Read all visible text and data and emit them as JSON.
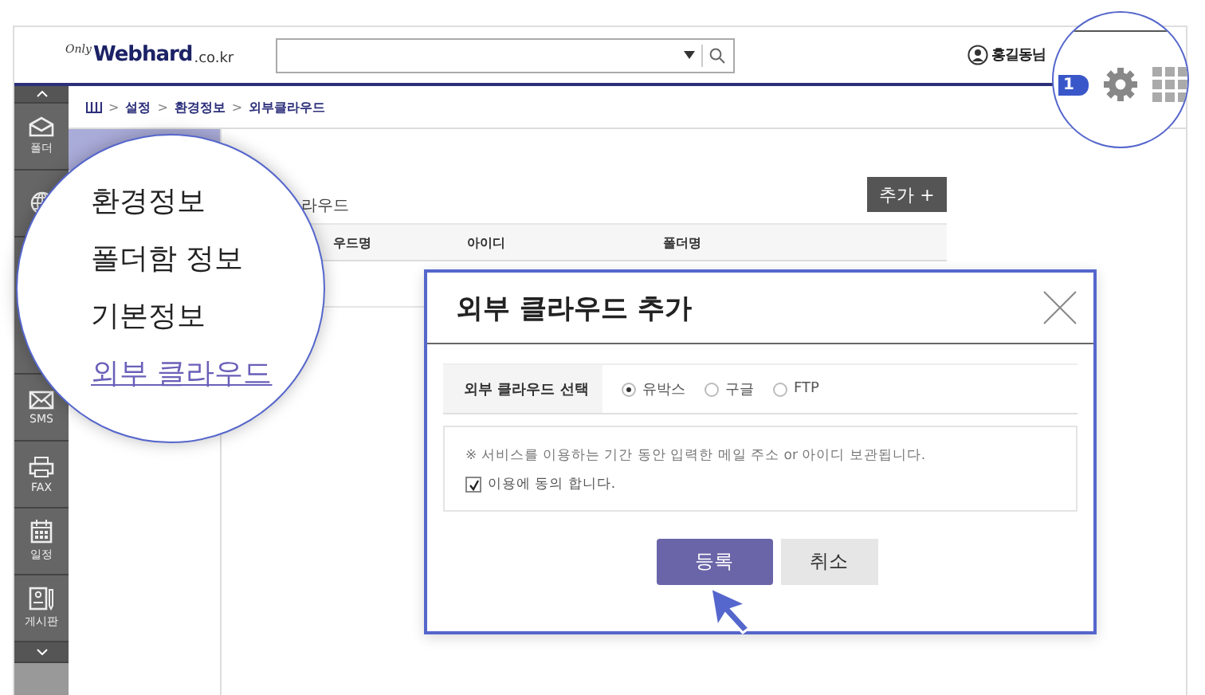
{
  "header": {
    "logo_prefix": "Only",
    "logo": "Webhard",
    "logo_suffix": ".co.kr",
    "user": "홍길동님"
  },
  "sidebar": {
    "items": [
      {
        "label": "폴더"
      },
      {
        "label": "SMS"
      },
      {
        "label": "FAX"
      },
      {
        "label": "일정"
      },
      {
        "label": "게시판"
      }
    ]
  },
  "breadcrumb": {
    "separator": ">",
    "items": [
      "설정",
      "환경정보",
      "외부클라우드"
    ]
  },
  "content": {
    "title": "라우드",
    "add_button": "추가 +",
    "columns": [
      "우드명",
      "아이디",
      "폴더명"
    ]
  },
  "magnifier_menu": [
    {
      "label": "환경정보",
      "selected": false
    },
    {
      "label": "폴더함 정보",
      "selected": false
    },
    {
      "label": "기본정보",
      "selected": false
    },
    {
      "label": "외부 클라우드",
      "selected": true
    }
  ],
  "magnifier_toolbar": {
    "badge": "1"
  },
  "dialog": {
    "title": "외부 클라우드 추가",
    "field_label": "외부 클라우드 선택",
    "options": [
      {
        "label": "유박스",
        "selected": true
      },
      {
        "label": "구글",
        "selected": false
      },
      {
        "label": "FTP",
        "selected": false
      }
    ],
    "notice": "※ 서비스를 이용하는 기간 동안 입력한 메일 주소 or 아이디 보관됩니다.",
    "agree": {
      "label": "이용에 동의 합니다.",
      "checked": true
    },
    "buttons": [
      {
        "label": "등록",
        "kind": "primary"
      },
      {
        "label": "취소",
        "kind": "secondary"
      }
    ]
  }
}
